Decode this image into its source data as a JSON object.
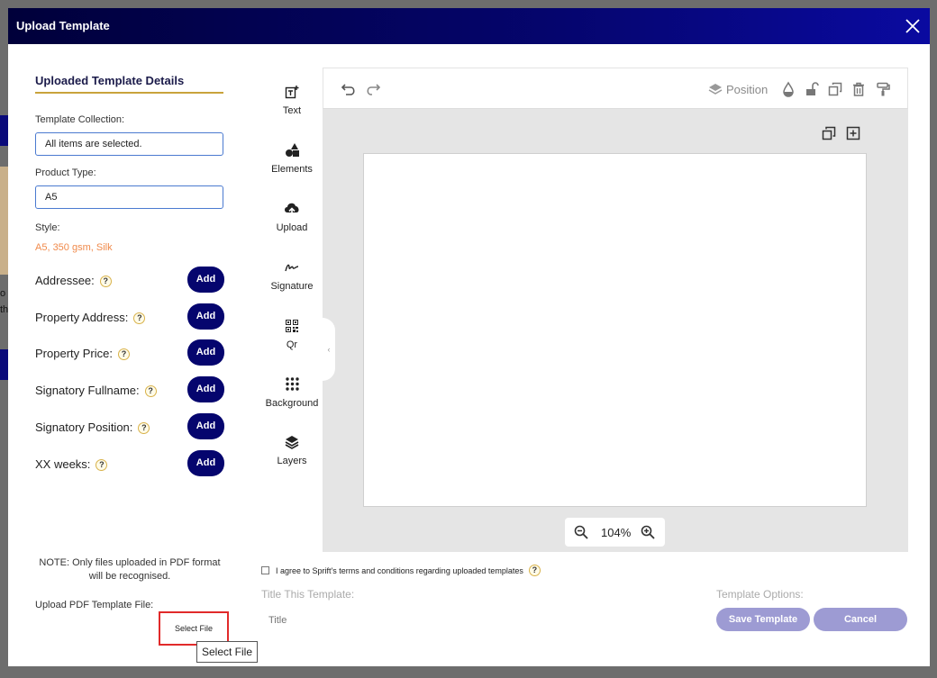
{
  "modal": {
    "title": "Upload Template"
  },
  "left": {
    "heading": "Uploaded Template Details",
    "collection_label": "Template Collection:",
    "collection_value": "All items are selected.",
    "product_label": "Product Type:",
    "product_value": "A5",
    "style_label": "Style:",
    "style_value": "A5, 350 gsm, Silk",
    "placeholders": [
      {
        "label": "Addressee:",
        "button": "Add"
      },
      {
        "label": "Property Address:",
        "button": "Add"
      },
      {
        "label": "Property Price:",
        "button": "Add"
      },
      {
        "label": "Signatory Fullname:",
        "button": "Add"
      },
      {
        "label": "Signatory Position:",
        "button": "Add"
      },
      {
        "label": "XX weeks:",
        "button": "Add"
      }
    ],
    "help_glyph": "?",
    "note": "NOTE: Only files uploaded in PDF format will be recognised.",
    "upload_label": "Upload PDF Template File:",
    "select_file": "Select File",
    "tooltip": "Select File"
  },
  "tools": [
    {
      "label": "Text",
      "icon": "text-add-icon"
    },
    {
      "label": "Elements",
      "icon": "shapes-icon"
    },
    {
      "label": "Upload",
      "icon": "cloud-upload-icon"
    },
    {
      "label": "Signature",
      "icon": "signature-icon"
    },
    {
      "label": "Qr",
      "icon": "qr-code-icon"
    },
    {
      "label": "Background",
      "icon": "dots-grid-icon"
    },
    {
      "label": "Layers",
      "icon": "layers-icon"
    }
  ],
  "editor": {
    "position_label": "Position",
    "zoom": "104%",
    "collapse_glyph": "‹"
  },
  "bottom": {
    "agree_text": "I agree to Sprift's terms and conditions regarding uploaded templates",
    "title_label": "Title This Template:",
    "title_placeholder": "Title",
    "options_label": "Template Options:",
    "save_button": "Save Template",
    "cancel_button": "Cancel"
  },
  "background_page": {
    "edge_text_1": "o",
    "edge_text_2": "th"
  },
  "colors": {
    "header": "#05056e",
    "accent_gold": "#c9a33b",
    "style_orange": "#f08a4b",
    "soft_button": "#9d9bd3",
    "highlight_red": "#e12a2a"
  }
}
